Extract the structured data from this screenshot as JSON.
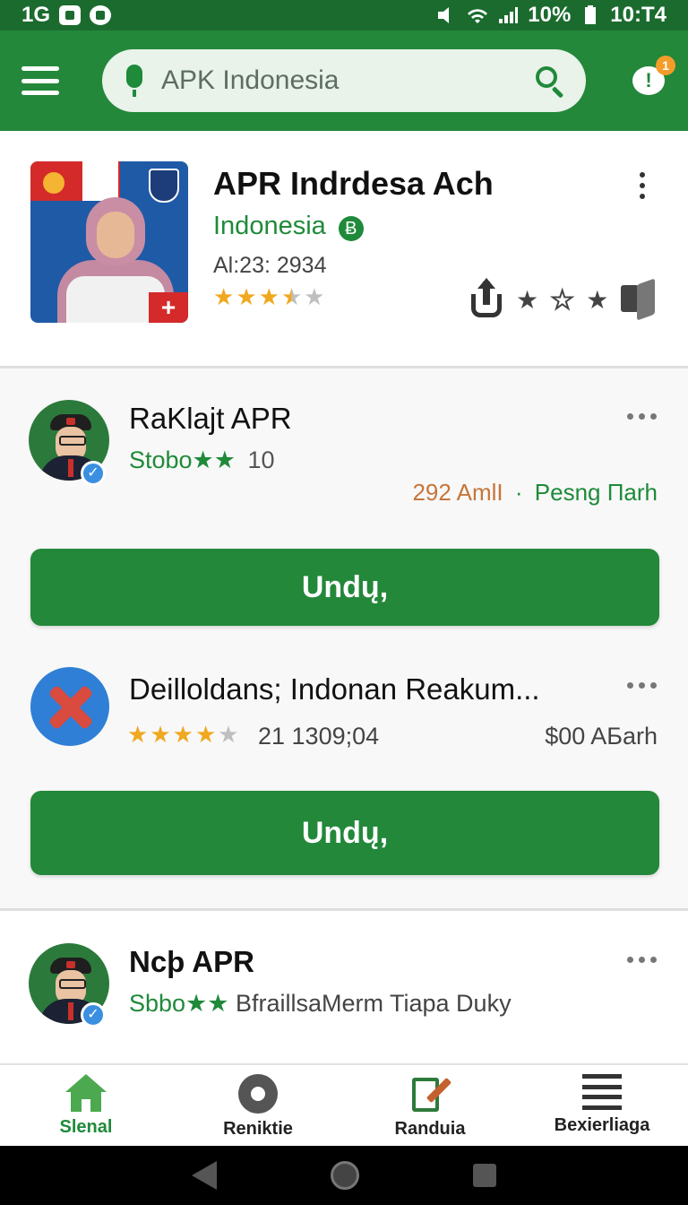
{
  "status_bar": {
    "network": "1G",
    "battery": "10%",
    "time": "10:T4"
  },
  "app_bar": {
    "search_placeholder": "APK Indonesia",
    "notification_count": "1",
    "notification_glyph": "!"
  },
  "featured": {
    "title": "APR Indrdesa Ach",
    "subtitle": "Indonesia",
    "subtitle_badge": "Ƀ",
    "meta": "Al:23: 2934",
    "rating": 3.5,
    "thumb_cross": "+"
  },
  "items": [
    {
      "title": "RaKlajt APR",
      "sub_green": "Stobo★★",
      "sub_count": "10",
      "meta_orange": "292 AmlI",
      "meta_sep": "·",
      "meta_green": "Pesng Пarh",
      "button_label": "Undų,"
    },
    {
      "title": "Deilloldans; Indonan Reakum...",
      "rating": 4,
      "meta": "21  1309;04",
      "price": "$00 AБarh",
      "button_label": "Undų,"
    },
    {
      "title": "Ncþ APR",
      "sub_green": "Sbbo★★",
      "sub_rest": "BfraillsaMerm Tiapa Duky"
    }
  ],
  "verified_glyph": "✓",
  "bottom_nav": [
    {
      "label": "Slenal",
      "icon": "home-icon",
      "active": true
    },
    {
      "label": "Reniktie",
      "icon": "gear-icon",
      "active": false
    },
    {
      "label": "Randuia",
      "icon": "edit-icon",
      "active": false
    },
    {
      "label": "Bexierliaga",
      "icon": "list-icon",
      "active": false
    }
  ],
  "colors": {
    "brand_green": "#23883a",
    "status_green": "#1b6b2f",
    "star_gold": "#f0a81f",
    "accent_orange": "#c5763a"
  }
}
